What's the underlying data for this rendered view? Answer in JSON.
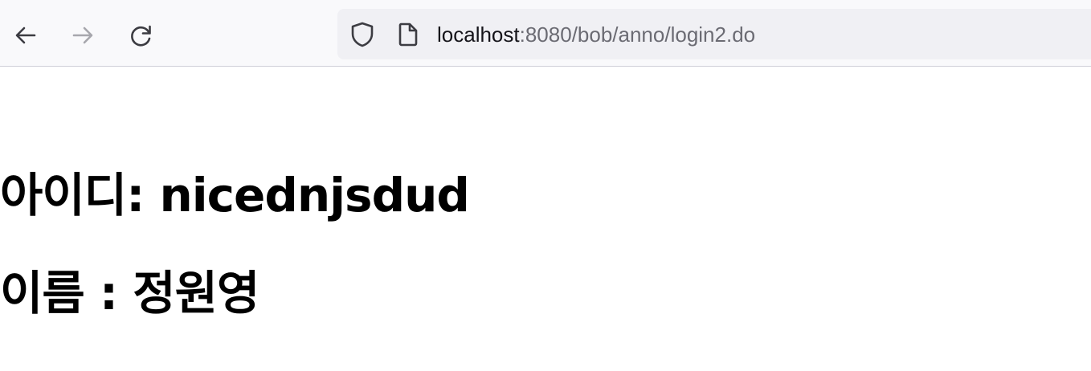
{
  "browser": {
    "url_host": "localhost",
    "url_rest": ":8080/bob/anno/login2.do",
    "icons": {
      "back": "arrow-left-icon",
      "forward": "arrow-right-icon",
      "reload": "reload-icon",
      "security": "shield-icon",
      "page": "document-icon"
    }
  },
  "page": {
    "id_line": "아이디: nicednjsdud",
    "name_line": "이름 : 정원영"
  }
}
